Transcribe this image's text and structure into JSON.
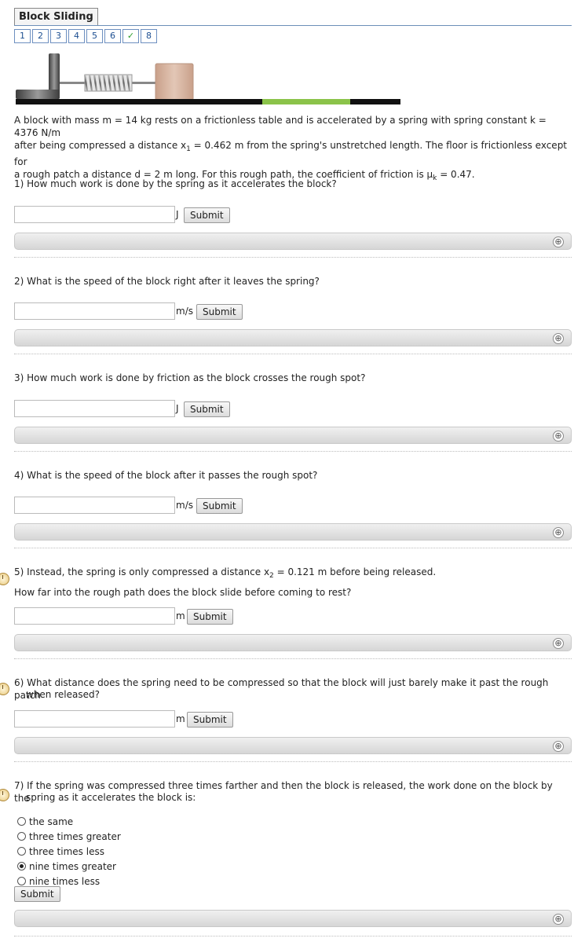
{
  "title": "Block Sliding",
  "parts": [
    {
      "label": "1",
      "state": "normal"
    },
    {
      "label": "2",
      "state": "normal"
    },
    {
      "label": "3",
      "state": "normal"
    },
    {
      "label": "4",
      "state": "normal"
    },
    {
      "label": "5",
      "state": "normal"
    },
    {
      "label": "6",
      "state": "normal"
    },
    {
      "label": "✓",
      "state": "done"
    },
    {
      "label": "8",
      "state": "normal"
    }
  ],
  "problem": {
    "line1": "A block with mass m = 14 kg rests on a frictionless table and is accelerated by a spring with spring constant k = 4376 N/m",
    "line2_pre": "after being compressed a distance x",
    "line2_sub": "1",
    "line2_post": " = 0.462 m from the spring's unstretched length. The floor is frictionless except for",
    "line3_pre": "a rough patch a distance d = 2 m long. For this rough path, the coefficient of friction is μ",
    "line3_sub": "k",
    "line3_post": " = 0.47."
  },
  "questions": {
    "q1": {
      "text": "1) How much work is done by the spring as it accelerates the block?",
      "unit": "J",
      "submit": "Submit",
      "value": ""
    },
    "q2": {
      "text": "2) What is the speed of the block right after it leaves the spring?",
      "unit": "m/s",
      "submit": "Submit",
      "value": ""
    },
    "q3": {
      "text": "3) How much work is done by friction as the block crosses the rough spot?",
      "unit": "J",
      "submit": "Submit",
      "value": ""
    },
    "q4": {
      "text": "4) What is the speed of the block after it passes the rough spot?",
      "unit": "m/s",
      "submit": "Submit",
      "value": ""
    },
    "q5": {
      "text_pre": "5) Instead, the spring is only compressed a distance x",
      "text_sub": "2",
      "text_post": " = 0.121 m before being released.",
      "text2": "How far into the rough path does the block slide before coming to rest?",
      "unit": "m",
      "submit": "Submit",
      "value": ""
    },
    "q6": {
      "line1": "6) What distance does the spring need to be compressed so that the block will just barely make it past the rough patch",
      "line2": "when released?",
      "unit": "m",
      "submit": "Submit",
      "value": ""
    },
    "q7": {
      "line1": "7) If the spring was compressed three times farther and then the block is released, the work done on the block by the",
      "line2": "spring as it accelerates the block is:",
      "options": [
        "the same",
        "three times greater",
        "three times less",
        "nine times greater",
        "nine times less"
      ],
      "selected": "nine times greater",
      "submit": "Submit"
    }
  },
  "hint_icon": "⊕",
  "colors": {
    "rough_patch": "#8bc34a",
    "floor": "#111111",
    "block": "#d8b8a4",
    "wall": "#555555",
    "check": "#2a9d2a"
  }
}
